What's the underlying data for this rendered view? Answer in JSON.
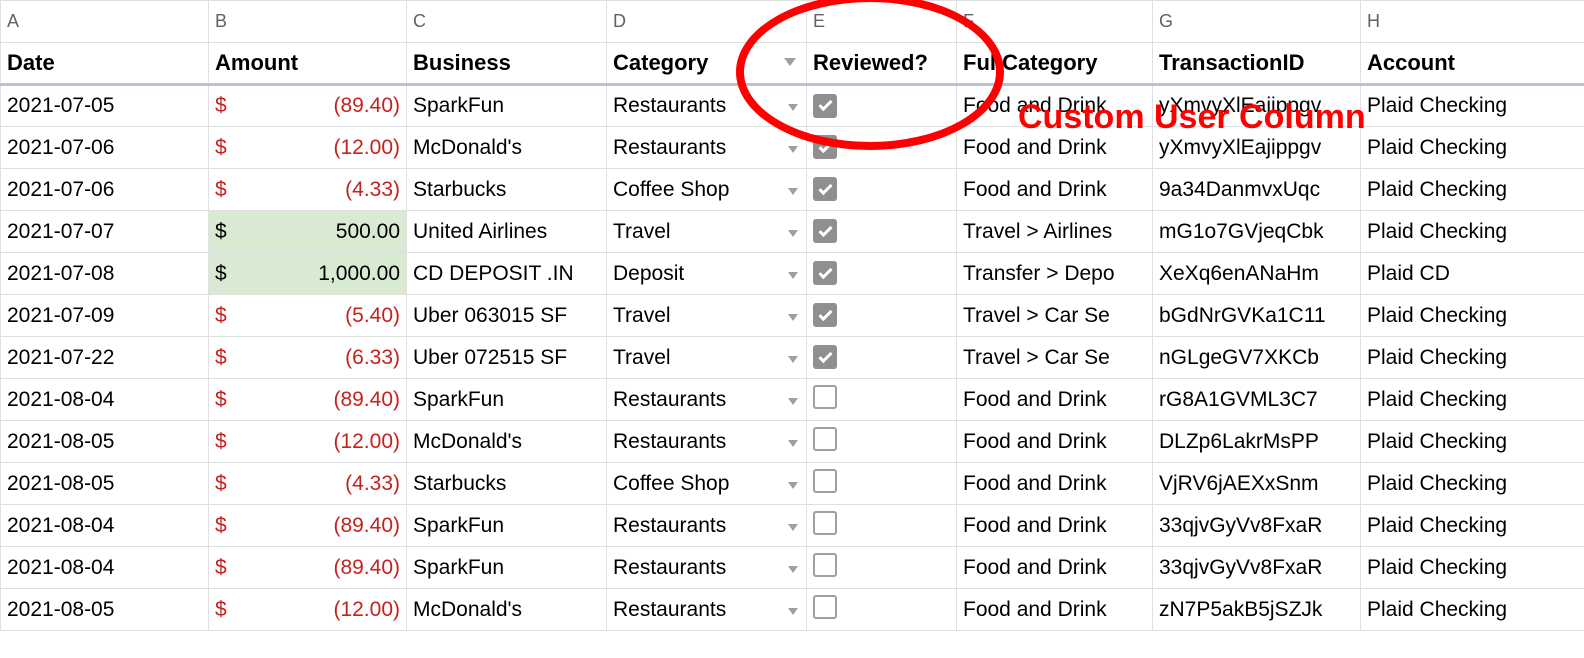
{
  "column_letters": [
    "A",
    "B",
    "C",
    "D",
    "E",
    "F",
    "G",
    "H"
  ],
  "headers": {
    "date": "Date",
    "amount": "Amount",
    "business": "Business",
    "category": "Category",
    "reviewed": "Reviewed?",
    "full_category_truncated": "Ful",
    "full_category": "Category",
    "transaction_id": "TransactionID",
    "account": "Account"
  },
  "annotation": "Custom User Column",
  "currency_symbol": "$",
  "rows": [
    {
      "date": "2021-07-05",
      "amount": "(89.40)",
      "neg": true,
      "business": "SparkFun",
      "category": "Restaurants",
      "reviewed": true,
      "full_partial_left": "Fo",
      "full": "Food and Drink",
      "tid": "yXmvyXlEajippgv",
      "account": "Plaid Checking",
      "account_truncated": "hecking"
    },
    {
      "date": "2021-07-06",
      "amount": "(12.00)",
      "neg": true,
      "business": "McDonald's",
      "category": "Restaurants",
      "reviewed": true,
      "full": "Food and Drink",
      "tid": "yXmvyXlEajippgv",
      "account": "Plaid Checking"
    },
    {
      "date": "2021-07-06",
      "amount": "(4.33)",
      "neg": true,
      "business": "Starbucks",
      "category": "Coffee Shop",
      "reviewed": true,
      "full": "Food and Drink",
      "tid": "9a34DanmvxUqc",
      "account": "Plaid Checking"
    },
    {
      "date": "2021-07-07",
      "amount": "500.00",
      "neg": false,
      "business": "United Airlines",
      "category": "Travel",
      "reviewed": true,
      "full": "Travel > Airlines",
      "tid": "mG1o7GVjeqCbk",
      "account": "Plaid Checking"
    },
    {
      "date": "2021-07-08",
      "amount": "1,000.00",
      "neg": false,
      "business": "CD DEPOSIT .IN",
      "category": "Deposit",
      "reviewed": true,
      "full": "Transfer > Depo",
      "tid": "XeXq6enANaHm",
      "account": "Plaid CD"
    },
    {
      "date": "2021-07-09",
      "amount": "(5.40)",
      "neg": true,
      "business": "Uber 063015 SF",
      "category": "Travel",
      "reviewed": true,
      "full": "Travel > Car Se",
      "tid": "bGdNrGVKa1C11",
      "account": "Plaid Checking"
    },
    {
      "date": "2021-07-22",
      "amount": "(6.33)",
      "neg": true,
      "business": "Uber 072515 SF",
      "category": "Travel",
      "reviewed": true,
      "full": "Travel > Car Se",
      "tid": "nGLgeGV7XKCb",
      "account": "Plaid Checking"
    },
    {
      "date": "2021-08-04",
      "amount": "(89.40)",
      "neg": true,
      "business": "SparkFun",
      "category": "Restaurants",
      "reviewed": false,
      "full": "Food and Drink",
      "tid": "rG8A1GVML3C7",
      "account": "Plaid Checking"
    },
    {
      "date": "2021-08-05",
      "amount": "(12.00)",
      "neg": true,
      "business": "McDonald's",
      "category": "Restaurants",
      "reviewed": false,
      "full": "Food and Drink",
      "tid": "DLZp6LakrMsPP",
      "account": "Plaid Checking"
    },
    {
      "date": "2021-08-05",
      "amount": "(4.33)",
      "neg": true,
      "business": "Starbucks",
      "category": "Coffee Shop",
      "reviewed": false,
      "full": "Food and Drink",
      "tid": "VjRV6jAEXxSnm",
      "account": "Plaid Checking"
    },
    {
      "date": "2021-08-04",
      "amount": "(89.40)",
      "neg": true,
      "business": "SparkFun",
      "category": "Restaurants",
      "reviewed": false,
      "full": "Food and Drink",
      "tid": "33qjvGyVv8FxaR",
      "account": "Plaid Checking"
    },
    {
      "date": "2021-08-04",
      "amount": "(89.40)",
      "neg": true,
      "business": "SparkFun",
      "category": "Restaurants",
      "reviewed": false,
      "full": "Food and Drink",
      "tid": "33qjvGyVv8FxaR",
      "account": "Plaid Checking"
    },
    {
      "date": "2021-08-05",
      "amount": "(12.00)",
      "neg": true,
      "business": "McDonald's",
      "category": "Restaurants",
      "reviewed": false,
      "full": "Food and Drink",
      "tid": "zN7P5akB5jSZJk",
      "account": "Plaid Checking"
    }
  ]
}
